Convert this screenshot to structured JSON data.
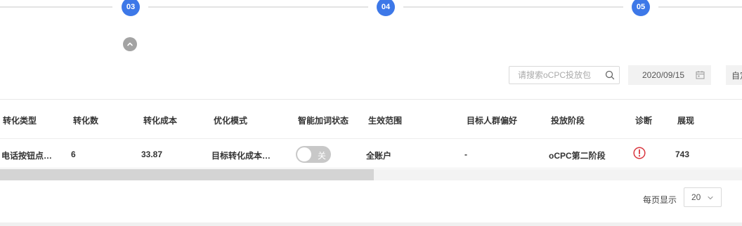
{
  "stepper": {
    "steps": [
      {
        "label": "03"
      },
      {
        "label": "04"
      },
      {
        "label": "05"
      }
    ]
  },
  "toolbar": {
    "search_placeholder": "请搜索oCPC投放包",
    "date_value": "2020/09/15",
    "more_label": "自定义"
  },
  "table": {
    "headers": [
      "转化类型",
      "转化数",
      "转化成本",
      "优化模式",
      "智能加词状态",
      "生效范围",
      "目标人群偏好",
      "投放阶段",
      "诊断",
      "展现"
    ],
    "row": {
      "conversion_type": "电话按钮点…",
      "conversions": "6",
      "cost": "33.87",
      "mode": "目标转化成本…",
      "smart_word_toggle": "关",
      "scope": "全账户",
      "audience": "-",
      "stage": "oCPC第二阶段",
      "impressions": "743"
    }
  },
  "pagination": {
    "per_page_label": "每页显示",
    "per_page_value": "20"
  },
  "colors": {
    "accent": "#3d78e8",
    "diagnosis": "#d9363e"
  },
  "icons": [
    "chevron-up-icon",
    "search-icon",
    "calendar-icon",
    "alert-circle-icon",
    "chevron-down-icon"
  ]
}
